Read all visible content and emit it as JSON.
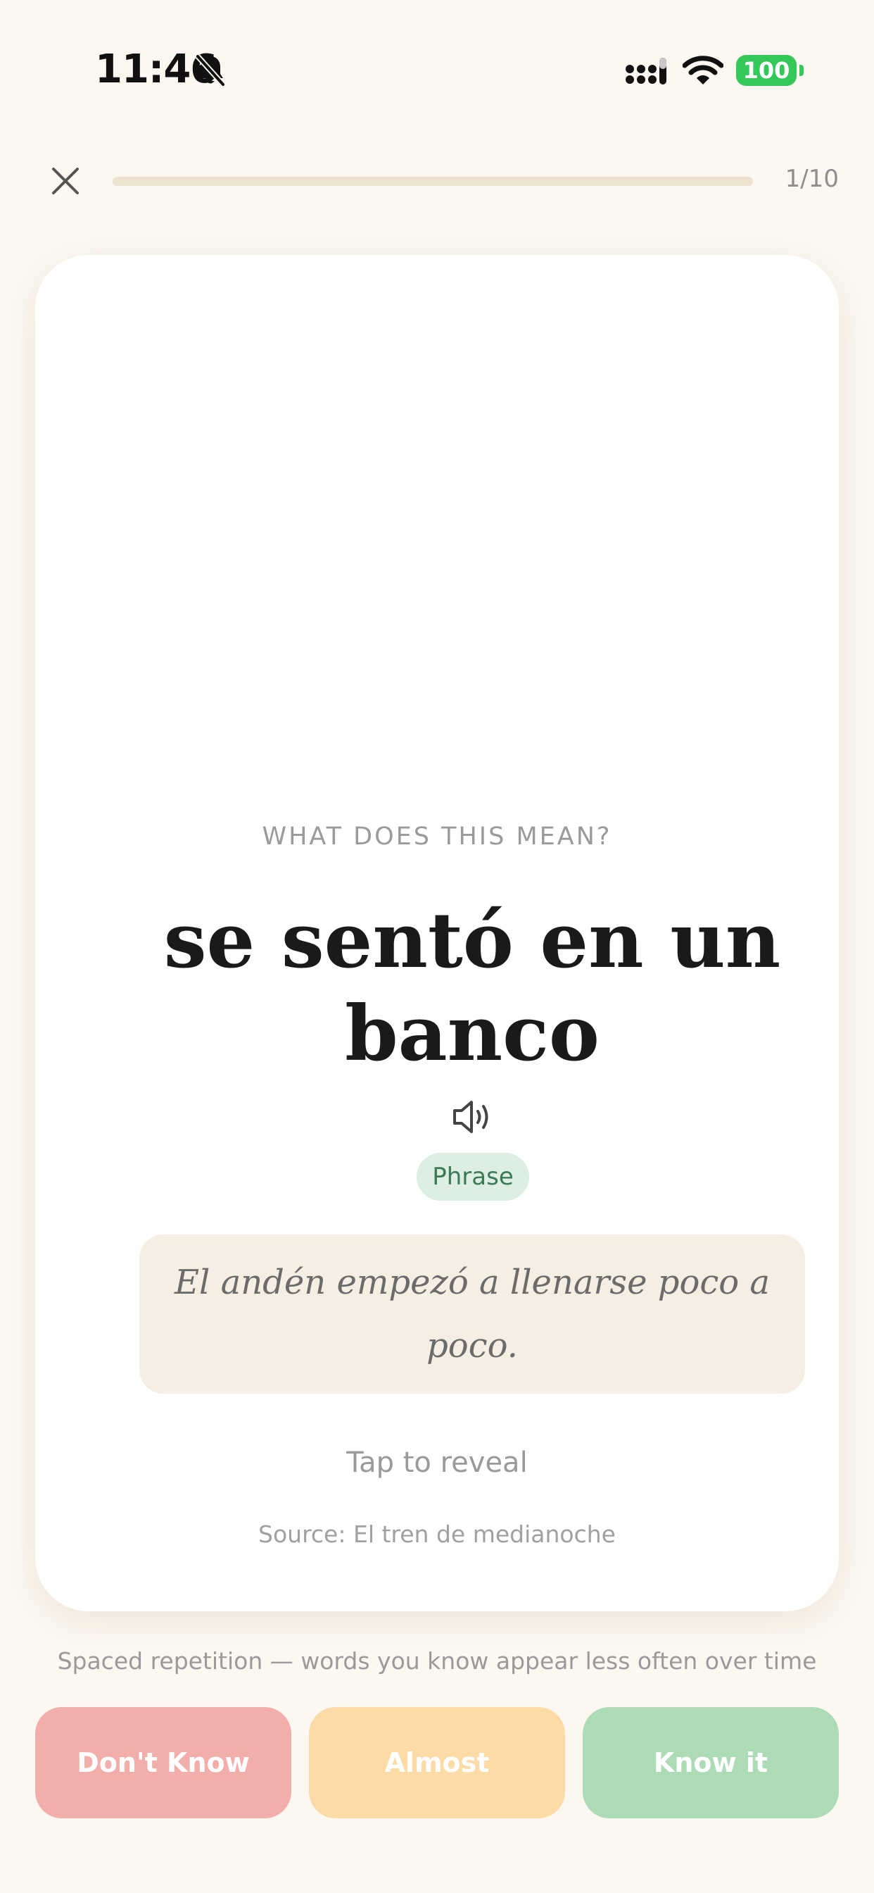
{
  "status_bar": {
    "time": "11:46",
    "battery": "100",
    "icons": [
      "bell-off-icon",
      "signal-icon",
      "wifi-icon",
      "battery-icon"
    ],
    "battery_color": "#34c759"
  },
  "header": {
    "close_icon": "close-icon",
    "progress_label": "1/10",
    "progress_fraction": 0
  },
  "card": {
    "prompt": "WHAT DOES THIS MEAN?",
    "term": "se sentó en un banco",
    "audio_icon": "speaker-icon",
    "type_badge": "Phrase",
    "example": "El andén empezó a llenarse poco a poco.",
    "reveal_label": "Tap to reveal",
    "source": "Source: El tren de medianoche"
  },
  "footer": {
    "hint": "Spaced repetition — words you know appear less often over time",
    "buttons": {
      "dont_know": "Don't Know",
      "almost": "Almost",
      "know_it": "Know it"
    }
  },
  "colors": {
    "background": "#fcf8f1",
    "card": "#ffffff",
    "badge_bg": "#dcefe2",
    "badge_text": "#3c7a55",
    "example_bg": "#f5efe3",
    "dont_know": "#f2aeaa",
    "almost": "#fcdba6",
    "know_it": "#acdbb6"
  }
}
